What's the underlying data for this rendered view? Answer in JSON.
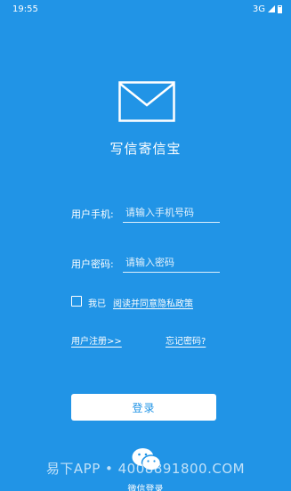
{
  "status_bar": {
    "time": "19:55",
    "network": "3G"
  },
  "app": {
    "title": "写信寄信宝"
  },
  "phone_field": {
    "label": "用户手机:",
    "placeholder": "请输入手机号码"
  },
  "password_field": {
    "label": "用户密码:",
    "placeholder": "请输入密码"
  },
  "agreement": {
    "prefix": "我已",
    "link": "阅读并同意隐私政策",
    "checked": false
  },
  "links": {
    "register": "用户注册>>",
    "forgot_password": "忘记密码?"
  },
  "login_button": {
    "label": "登录"
  },
  "wechat_login": {
    "label": "微信登录",
    "icon": "wechat-icon"
  },
  "watermark": {
    "text": "易下APP • 4008891800.COM"
  },
  "colors": {
    "background": "#2194E6",
    "button": "#FFFFFF",
    "button_text": "#2194E6"
  }
}
